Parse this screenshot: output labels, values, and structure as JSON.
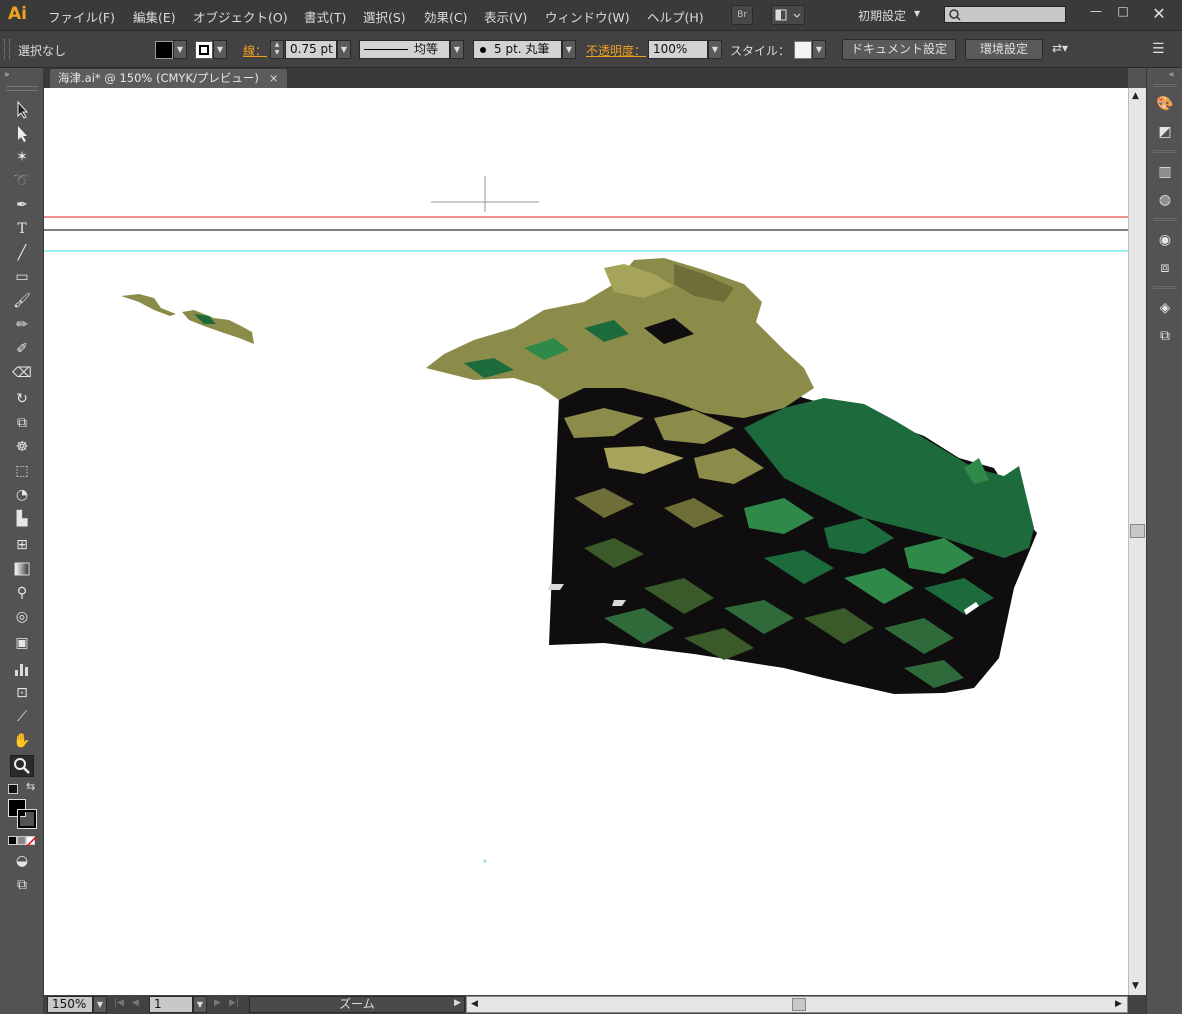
{
  "app": {
    "logo": "Ai"
  },
  "menu": [
    "ファイル(F)",
    "編集(E)",
    "オブジェクト(O)",
    "書式(T)",
    "選択(S)",
    "効果(C)",
    "表示(V)",
    "ウィンドウ(W)",
    "ヘルプ(H)"
  ],
  "menubar": {
    "bridge_label": "Br",
    "workspace": "初期設定"
  },
  "control": {
    "selection": "選択なし",
    "stroke_label": "線：",
    "stroke_weight": "0.75 pt",
    "profile": "均等",
    "brush": "5 pt. 丸筆",
    "opacity_label": "不透明度：",
    "opacity": "100%",
    "style_label": "スタイル：",
    "doc_setup": "ドキュメント設定",
    "preferences": "環境設定"
  },
  "tab": {
    "title": "海津.ai* @ 150% (CMYK/プレビュー)",
    "close": "×"
  },
  "status": {
    "zoom": "150%",
    "artboard": "1",
    "tool_label": "ズーム"
  },
  "colors": {
    "accent": "#f2a31c",
    "guide_red": "#e02020",
    "guide_cyan": "#40e0e0",
    "foliage_dark": "#111111",
    "foliage_green": "#1d6b3c",
    "foliage_olive": "#8c8c4a"
  },
  "tools": [
    "selection-icon",
    "direct-selection-icon",
    "magic-wand-icon",
    "lasso-icon",
    "pen-icon",
    "type-icon",
    "line-icon",
    "rectangle-icon",
    "paintbrush-icon",
    "pencil-icon",
    "blob-brush-icon",
    "eraser-icon",
    "rotate-icon",
    "scale-icon",
    "warp-icon",
    "free-transform-icon",
    "shape-builder-icon",
    "perspective-grid-icon",
    "mesh-icon",
    "gradient-icon",
    "eyedropper-icon",
    "blend-icon",
    "symbol-sprayer-icon",
    "graph-icon",
    "artboard-icon",
    "slice-icon",
    "hand-icon",
    "zoom-icon"
  ],
  "dock": [
    "color-guide-icon",
    "color-icon",
    "gradient-panel-icon",
    "transparency-icon",
    "appearance-icon",
    "graphic-styles-icon",
    "layers-icon",
    "artboards-icon"
  ]
}
